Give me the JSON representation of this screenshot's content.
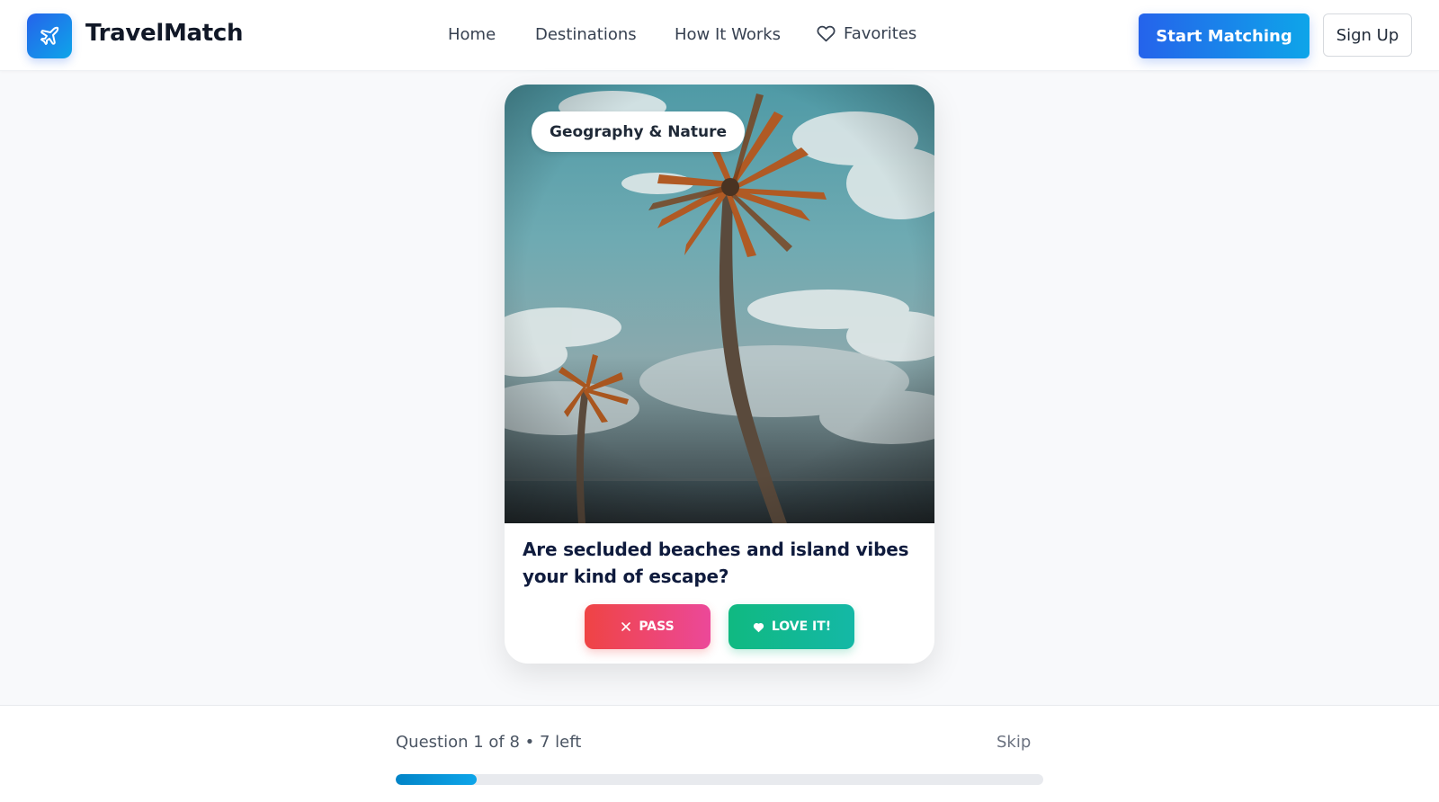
{
  "brand": {
    "name": "TravelMatch",
    "logo_icon": "airplane-icon",
    "accent_start": "#2563eb",
    "accent_end": "#0ea5e9"
  },
  "nav": {
    "home": "Home",
    "destinations": "Destinations",
    "how_it_works": "How It Works",
    "favorites": "Favorites",
    "favorites_icon": "heart-outline-icon"
  },
  "header_actions": {
    "start_matching": "Start Matching",
    "sign_up": "Sign Up"
  },
  "card": {
    "image_subject": "palm trees over beach and sky",
    "category": "Geography & Nature",
    "question": "Are secluded beaches and island vibes your kind of escape?",
    "pass_label": "PASS",
    "pass_icon": "close-icon",
    "pass_color": "#ef4444",
    "love_label": "LOVE IT!",
    "love_icon": "heart-icon",
    "love_color": "#10b981"
  },
  "progress": {
    "text": "Question 1 of 8 • 7 left",
    "skip": "Skip",
    "current": 1,
    "total": 8,
    "fraction": 0.125
  }
}
